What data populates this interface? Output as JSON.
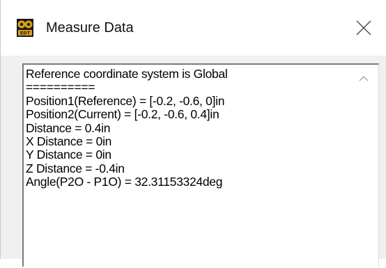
{
  "window": {
    "title": "Measure Data",
    "app_icon": "edt-logo-icon",
    "close_icon": "close-icon",
    "close_label": "×"
  },
  "output": {
    "lines": [
      "Reference coordinate system is Global",
      "==========",
      "Position1(Reference) = [-0.2, -0.6, 0]in",
      "Position2(Current) = [-0.2, -0.6, 0.4]in",
      "Distance = 0.4in",
      "X Distance = 0in",
      "Y Distance = 0in",
      "Z Distance = -0.4in",
      "Angle(P2O - P1O) = 32.31153324deg"
    ]
  },
  "scrollbar": {
    "up_icon": "chevron-up-icon"
  },
  "colors": {
    "window_bg": "#f0f0f0",
    "titlebar_bg": "#ffffff",
    "icon_gold": "#c8960c"
  }
}
